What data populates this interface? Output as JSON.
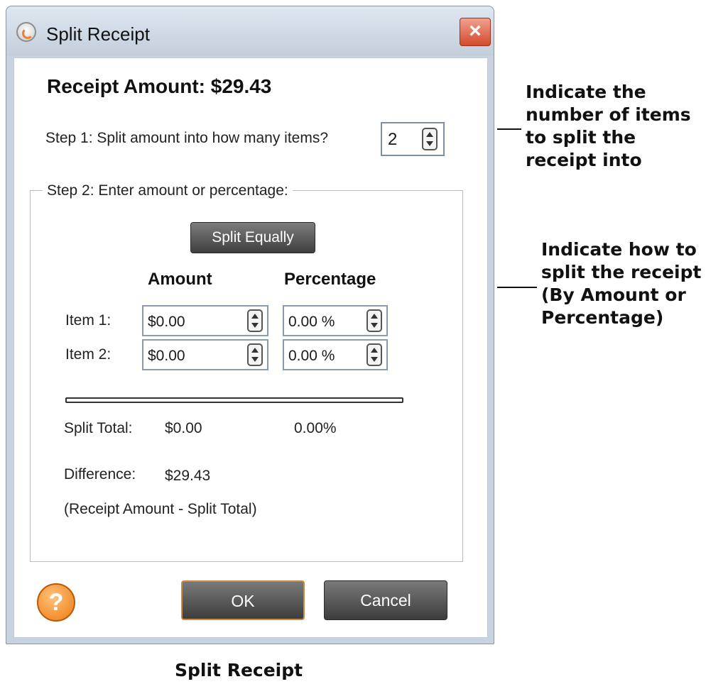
{
  "window": {
    "title": "Split Receipt",
    "close_icon": "×"
  },
  "receipt_amount": "Receipt Amount: $29.43",
  "step1": {
    "label": "Step 1: Split amount into how many items?",
    "value": "2"
  },
  "step2": {
    "label": "Step 2: Enter amount or percentage:",
    "split_equally": "Split Equally",
    "amount_header": "Amount",
    "percentage_header": "Percentage",
    "items": [
      {
        "label": "Item 1:",
        "amount": "$0.00",
        "percentage": "0.00 %"
      },
      {
        "label": "Item 2:",
        "amount": "$0.00",
        "percentage": "0.00 %"
      }
    ],
    "split_total_label": "Split Total:",
    "split_total_amount": "$0.00",
    "split_total_percentage": "0.00%",
    "difference_label": "Difference:",
    "difference_value": "$29.43",
    "difference_note": "(Receipt Amount - Split Total)"
  },
  "buttons": {
    "help": "?",
    "ok": "OK",
    "cancel": "Cancel"
  },
  "annotations": {
    "items": "Indicate the\nnumber of items\nto split the\nreceipt into",
    "split": "Indicate how to\nsplit the receipt\n(By Amount or\nPercentage)"
  },
  "caption": "Split Receipt",
  "colors": {
    "accent_orange": "#ee7a10",
    "close_red": "#d34a2c",
    "button_dark": "#3c3c3c"
  }
}
